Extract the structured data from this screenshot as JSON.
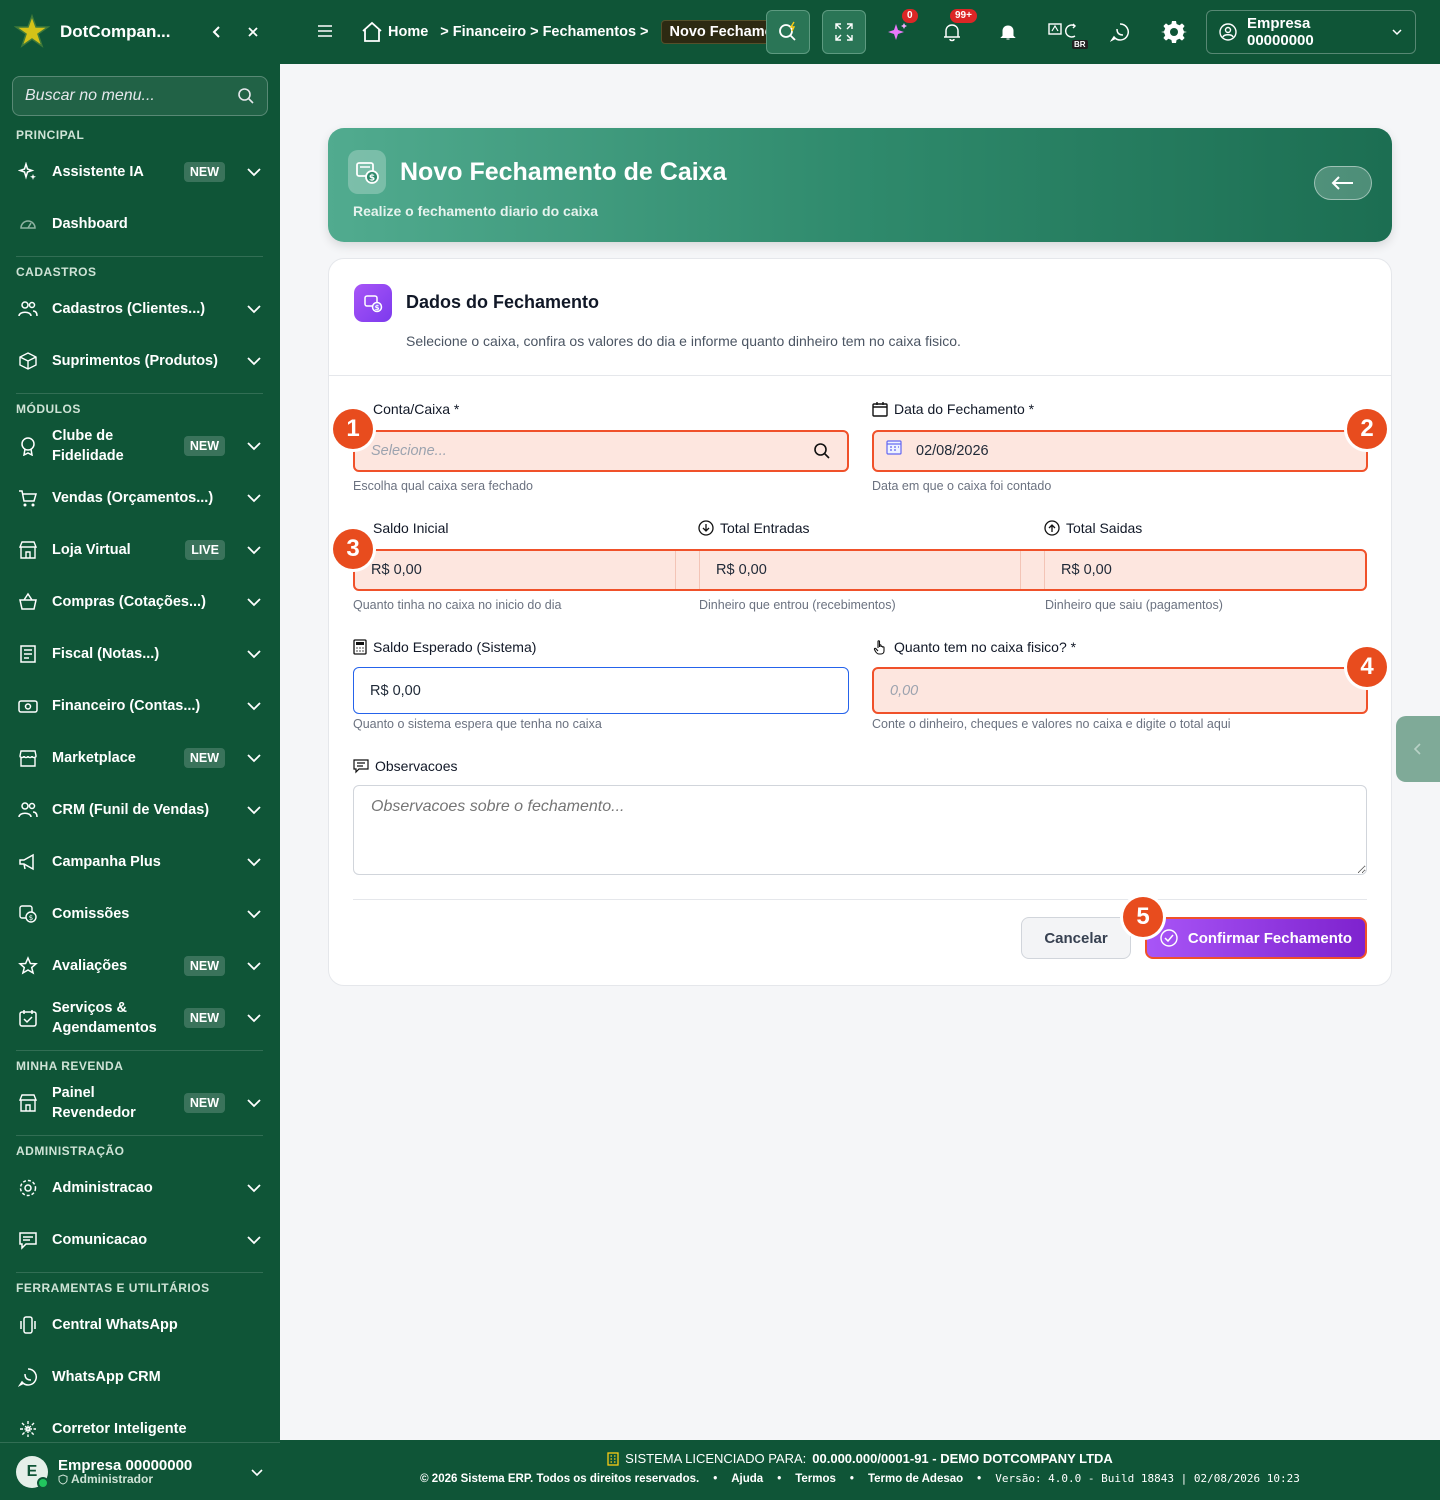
{
  "sidebar": {
    "brand": "DotCompan...",
    "search_placeholder": "Buscar no menu...",
    "sections": {
      "principal": "PRINCIPAL",
      "cadastros": "CADASTROS",
      "modulos": "MÓDULOS",
      "revenda": "MINHA REVENDA",
      "admin": "ADMINISTRAÇÃO",
      "ferramentas": "FERRAMENTAS E UTILITÁRIOS"
    },
    "items": {
      "assistente": {
        "label": "Assistente IA",
        "badge": "NEW"
      },
      "dashboard": {
        "label": "Dashboard"
      },
      "cadastros": {
        "label": "Cadastros (Clientes...)"
      },
      "suprimentos": {
        "label": "Suprimentos (Produtos)"
      },
      "clube": {
        "label": "Clube de Fidelidade",
        "badge": "NEW"
      },
      "vendas": {
        "label": "Vendas (Orçamentos...)"
      },
      "loja": {
        "label": "Loja Virtual",
        "badge": "LIVE"
      },
      "compras": {
        "label": "Compras (Cotações...)"
      },
      "fiscal": {
        "label": "Fiscal (Notas...)"
      },
      "financeiro": {
        "label": "Financeiro (Contas...)"
      },
      "marketplace": {
        "label": "Marketplace",
        "badge": "NEW"
      },
      "crm": {
        "label": "CRM (Funil de Vendas)"
      },
      "campanha": {
        "label": "Campanha Plus"
      },
      "comissoes": {
        "label": "Comissões"
      },
      "avaliacoes": {
        "label": "Avaliações",
        "badge": "NEW"
      },
      "servicos": {
        "label": "Serviços & Agendamentos",
        "badge": "NEW"
      },
      "painel": {
        "label": "Painel Revendedor",
        "badge": "NEW"
      },
      "administracao": {
        "label": "Administracao"
      },
      "comunicacao": {
        "label": "Comunicacao"
      },
      "central_whatsapp": {
        "label": "Central WhatsApp"
      },
      "whatsapp_crm": {
        "label": "WhatsApp CRM"
      },
      "corretor": {
        "label": "Corretor Inteligente"
      }
    },
    "user": {
      "initial": "E",
      "name": "Empresa 00000000",
      "role": "Administrador"
    }
  },
  "topbar": {
    "breadcrumb": [
      "Home",
      "Financeiro",
      "Fechamentos",
      "Novo Fechamento"
    ],
    "ai_count": "0",
    "notif_count": "99+",
    "lang": "BR",
    "company": "Empresa 00000000"
  },
  "hero": {
    "title": "Novo Fechamento de Caixa",
    "subtitle": "Realize o fechamento diario do caixa"
  },
  "form": {
    "title": "Dados do Fechamento",
    "subtitle": "Selecione o caixa, confira os valores do dia e informe quanto dinheiro tem no caixa fisico.",
    "conta": {
      "label": "Conta/Caixa *",
      "placeholder": "Selecione...",
      "help": "Escolha qual caixa sera fechado"
    },
    "data": {
      "label": "Data do Fechamento *",
      "value": "02/08/2026",
      "help": "Data em que o caixa foi contado"
    },
    "saldo_inicial": {
      "label": "Saldo Inicial",
      "value": "R$ 0,00",
      "help": "Quanto tinha no caixa no inicio do dia"
    },
    "total_entradas": {
      "label": "Total Entradas",
      "value": "R$ 0,00",
      "help": "Dinheiro que entrou (recebimentos)"
    },
    "total_saidas": {
      "label": "Total Saidas",
      "value": "R$ 0,00",
      "help": "Dinheiro que saiu (pagamentos)"
    },
    "saldo_esperado": {
      "label": "Saldo Esperado (Sistema)",
      "value": "R$ 0,00",
      "help": "Quanto o sistema espera que tenha no caixa"
    },
    "caixa_fisico": {
      "label": "Quanto tem no caixa fisico? *",
      "placeholder": "0,00",
      "help": "Conte o dinheiro, cheques e valores no caixa e digite o total aqui"
    },
    "observacoes": {
      "label": "Observacoes",
      "placeholder": "Observacoes sobre o fechamento..."
    },
    "cancel_label": "Cancelar",
    "confirm_label": "Confirmar Fechamento"
  },
  "annotations": [
    "1",
    "2",
    "3",
    "4",
    "5"
  ],
  "footer": {
    "license_label": "SISTEMA LICENCIADO PARA:",
    "license_value": "00.000.000/0001-91 - DEMO DOTCOMPANY LTDA",
    "copyright": "© 2026 Sistema ERP. Todos os direitos reservados.",
    "links": [
      "Ajuda",
      "Termos",
      "Termo de Adesao"
    ],
    "version": "Versão: 4.0.0 - Build 18843 | 02/08/2026 10:23"
  },
  "colors": {
    "primary": "#0f5537",
    "accent": "#e84c1e",
    "purple": "#7e22ce",
    "highlight": "#fde6df"
  }
}
